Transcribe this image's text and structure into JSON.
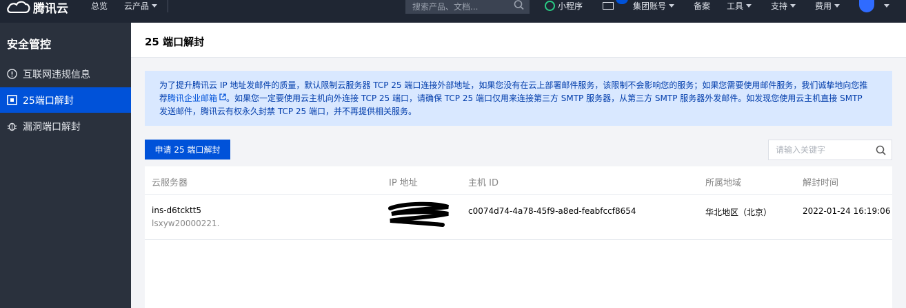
{
  "topbar": {
    "brand": "腾讯云",
    "nav": [
      "总览",
      "云产品"
    ],
    "search_placeholder": "搜索产品、文档...",
    "right": {
      "mini_program": "小程序",
      "group_account": "集团账号",
      "filing": "备案",
      "tools": "工具",
      "support": "支持",
      "billing": "费用"
    }
  },
  "sidebar": {
    "title": "安全管控",
    "items": [
      {
        "label": "互联网违规信息",
        "icon": "exclamation-circle-icon",
        "active": false
      },
      {
        "label": "25端口解封",
        "icon": "port-icon",
        "active": true
      },
      {
        "label": "漏洞端口解封",
        "icon": "bug-icon",
        "active": false
      }
    ]
  },
  "page": {
    "title": "25 端口解封"
  },
  "notice": {
    "line1": "为了提升腾讯云 IP 地址发邮件的质量，默认限制云服务器 TCP 25 端口连接外部地址，如果您没有在云上部署邮件服务，该限制不会影响您的服务；如果您需要使用邮件服务，我们诚挚地向您推",
    "line2_prefix": "荐",
    "line2_link": "腾讯企业邮箱",
    "line2_rest": "。如果您一定要使用云主机向外连接 TCP 25 端口，请确保 TCP 25 端口仅用来连接第三方 SMTP 服务器，从第三方 SMTP 服务器外发邮件。如发现您使用云主机直接 SMTP",
    "line3": "发送邮件，腾讯云有权永久封禁 TCP 25 端口，并不再提供相关服务。"
  },
  "actions": {
    "apply_button": "申请 25 端口解封",
    "keyword_placeholder": "请输入关键字"
  },
  "table": {
    "columns": [
      "云服务器",
      "IP 地址",
      "主机 ID",
      "所属地域",
      "解封时间"
    ],
    "rows": [
      {
        "server_id": "ins-d6tcktt5",
        "server_name": "lsxyw20000221.",
        "ip": "",
        "host_id": "c0074d74-4a78-45f9-a8ed-feabfccf8654",
        "region": "华北地区（北京）",
        "time": "2022-01-24 16:19:06"
      }
    ]
  },
  "colors": {
    "topbar_bg": "#1f2633",
    "sidebar_bg": "#2a313d",
    "accent": "#0052d9",
    "notice_bg": "#d9e8ff"
  }
}
